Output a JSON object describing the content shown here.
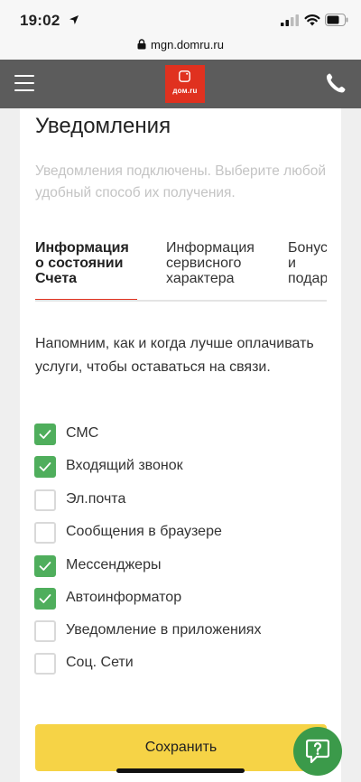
{
  "status_bar": {
    "time": "19:02",
    "icons": [
      "location-arrow-icon",
      "signal-icon",
      "wifi-icon",
      "battery-icon"
    ]
  },
  "browser": {
    "url": "mgn.domru.ru"
  },
  "header": {
    "logo_text": "дом.ru",
    "icons": [
      "menu-icon",
      "phone-icon"
    ]
  },
  "page": {
    "title": "Уведомления",
    "subtitle": "Уведомления подключены. Выберите любой удобный способ их получения.",
    "tabs": [
      {
        "line1": "Информация",
        "line2": "о состоянии",
        "line3": "Счета",
        "active": true
      },
      {
        "line1": "Информация",
        "line2": "сервисного",
        "line3": "характера",
        "active": false
      },
      {
        "line1": "Бонусы",
        "line2": "и",
        "line3": "подарки",
        "active": false
      }
    ],
    "description": "Напомним, как и когда лучше оплачивать услуги, чтобы оставаться на связи.",
    "options": [
      {
        "label": "СМС",
        "checked": true
      },
      {
        "label": "Входящий звонок",
        "checked": true
      },
      {
        "label": "Эл.почта",
        "checked": false
      },
      {
        "label": "Сообщения в браузере",
        "checked": false
      },
      {
        "label": "Мессенджеры",
        "checked": true
      },
      {
        "label": "Автоинформатор",
        "checked": true
      },
      {
        "label": "Уведомление в приложениях",
        "checked": false
      },
      {
        "label": "Соц. Сети",
        "checked": false
      }
    ],
    "save_label": "Сохранить"
  },
  "colors": {
    "accent_red": "#e0311f",
    "check_green": "#4fae5c",
    "save_yellow": "#f6d346",
    "chat_green": "#3b9a4a",
    "header_gray": "#5c5c5c"
  }
}
